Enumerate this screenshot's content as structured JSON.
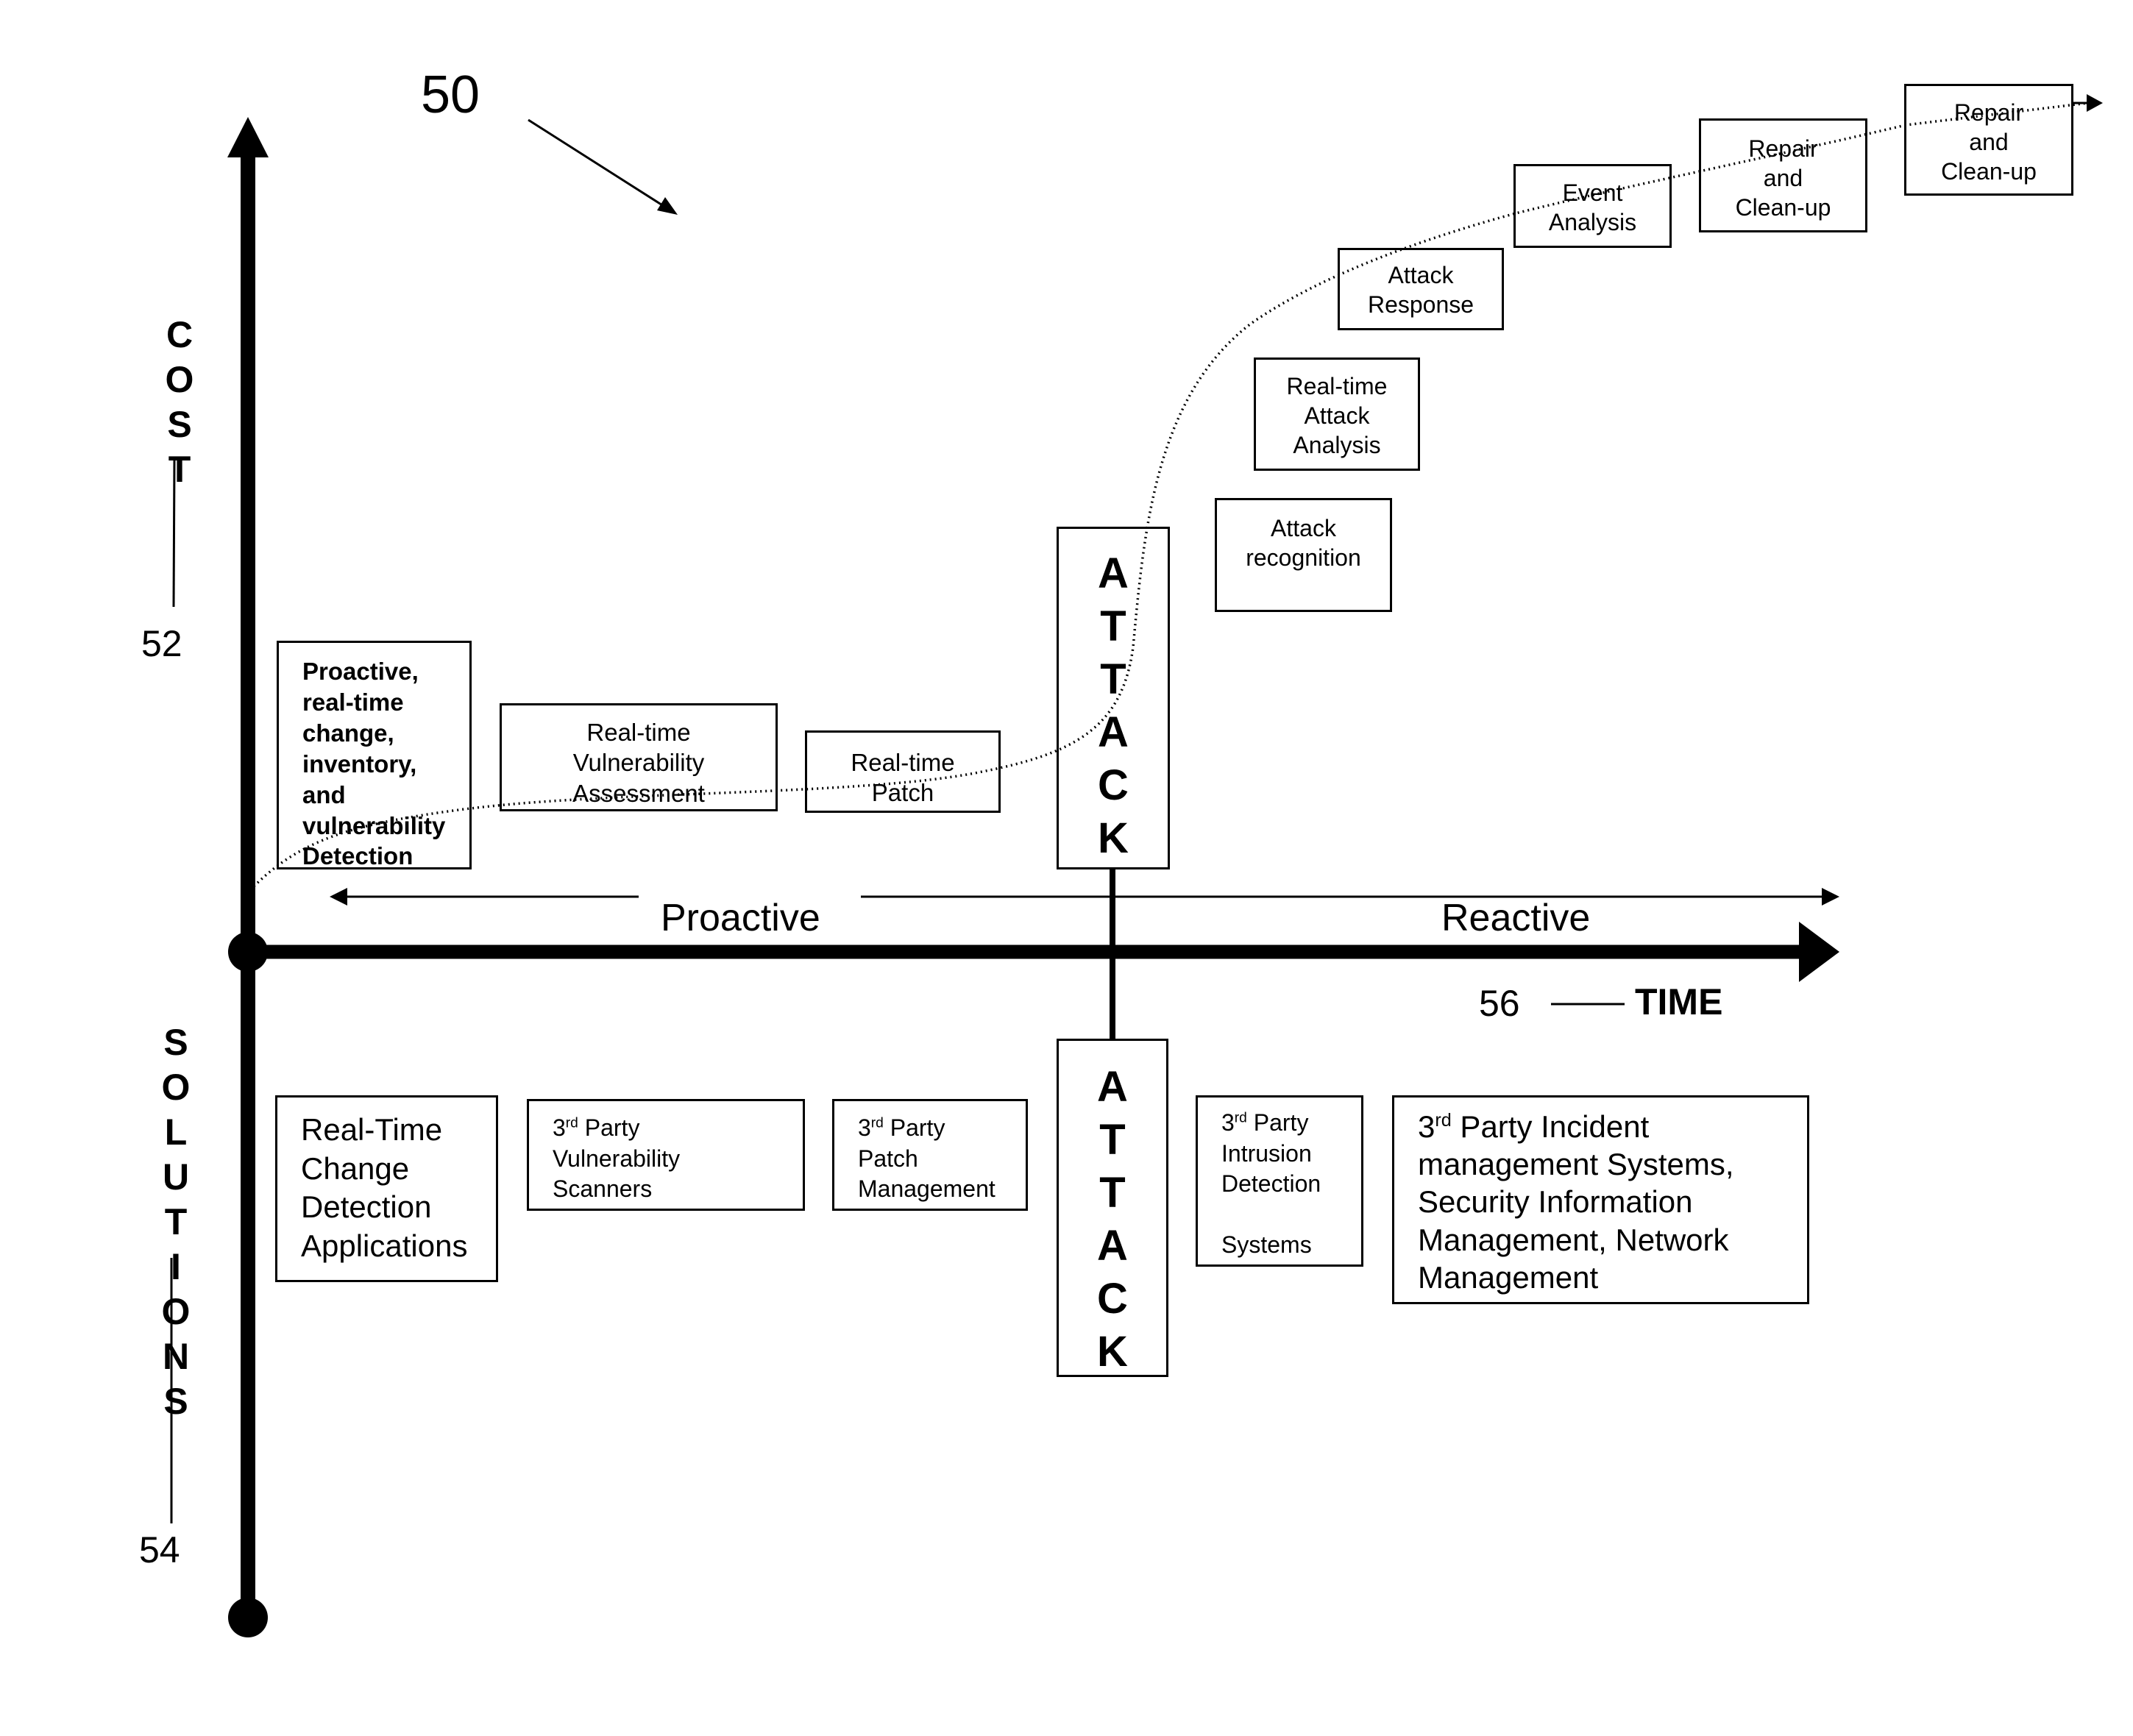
{
  "figure": {
    "reference_number": "50",
    "cost_axis": {
      "label": "COST",
      "reference": "52"
    },
    "solutions_axis": {
      "label": "SOLUTIONS",
      "reference": "54"
    },
    "time_axis": {
      "label": "TIME",
      "reference": "56"
    },
    "proactive_label": "Proactive",
    "reactive_label": "Reactive",
    "attack_label": "ATTACK"
  },
  "cost_boxes": [
    {
      "id": "proactive-detection",
      "text": "Proactive,\nreal-time\nchange,\ninventory,\nand\nvulnerability\nDetection",
      "bold": true
    },
    {
      "id": "rt-vulnerability-assessment",
      "text": "Real-time\nVulnerability\nAssessment"
    },
    {
      "id": "rt-patch",
      "text": "Real-time\nPatch"
    },
    {
      "id": "attack-recognition",
      "text": "Attack\nrecognition"
    },
    {
      "id": "rt-attack-analysis",
      "text": "Real-time\nAttack\nAnalysis"
    },
    {
      "id": "attack-response",
      "text": "Attack\nResponse"
    },
    {
      "id": "event-analysis",
      "text": "Event\nAnalysis"
    },
    {
      "id": "repair-cleanup-1",
      "text": "Repair\nand\nClean-up"
    },
    {
      "id": "repair-cleanup-2",
      "text": "Repair\nand\nClean-up"
    }
  ],
  "solution_boxes": [
    {
      "id": "rt-change-detection-apps",
      "lines": [
        "Real-Time",
        "Change",
        "Detection",
        "Applications"
      ]
    },
    {
      "id": "vuln-scanners",
      "ordinal": "3",
      "ordinal_suffix": "rd",
      "first_line_rest": " Party",
      "lines": [
        "Vulnerability",
        "Scanners"
      ]
    },
    {
      "id": "patch-management",
      "ordinal": "3",
      "ordinal_suffix": "rd",
      "first_line_rest": " Party",
      "lines": [
        "Patch",
        "Management"
      ]
    },
    {
      "id": "intrusion-detection",
      "ordinal": "3",
      "ordinal_suffix": "rd",
      "first_line_rest": " Party",
      "lines": [
        "Intrusion",
        "Detection",
        "",
        "Systems"
      ]
    },
    {
      "id": "incident-management",
      "ordinal": "3",
      "ordinal_suffix": "rd",
      "first_line_rest": " Party Incident",
      "lines": [
        "management Systems,",
        "Security Information",
        "Management, Network",
        "Management"
      ]
    }
  ]
}
